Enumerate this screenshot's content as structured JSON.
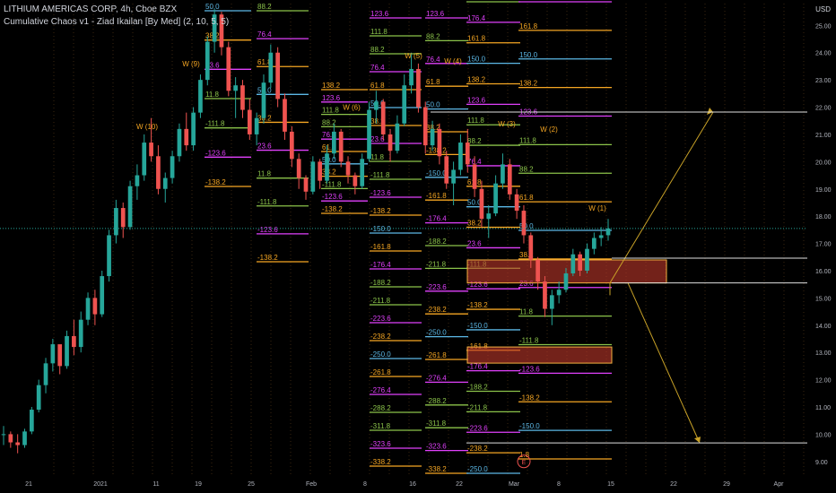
{
  "header": {
    "symbol_line": "LITHIUM AMERICAS CORP, 4h, Cboe BZX",
    "indicator_line": "Cumulative Chaos v1 - Ziad Ikailan [By Med] (2, 10, 5, 5)"
  },
  "currency": "USD",
  "colors": {
    "background": "#000000",
    "up": "#26a69a",
    "down": "#ef5350",
    "arrow": "#c9a227",
    "zone_fill": "#c0392b",
    "zone_border": "#f5b041"
  },
  "chart_data": {
    "type": "candlestick",
    "y_axis": {
      "min": 8.5,
      "max": 25.8,
      "ticks": [
        "25.00",
        "24.00",
        "23.00",
        "22.00",
        "21.00",
        "20.00",
        "19.00",
        "18.00",
        "17.00",
        "16.00",
        "15.00",
        "14.00",
        "13.00",
        "12.00",
        "11.00",
        "10.00",
        "9.00"
      ]
    },
    "x_axis": {
      "ticks": [
        "21",
        "2021",
        "11",
        "19",
        "25",
        "Feb",
        "8",
        "16",
        "22",
        "Mar",
        "8",
        "15",
        "22",
        "29",
        "Apr"
      ]
    },
    "price_tags": [
      {
        "value": "21.82",
        "style": "outline"
      },
      {
        "value": "17.55",
        "style": "current"
      },
      {
        "value": "16.46",
        "style": "outline"
      },
      {
        "value": "15.55",
        "style": "outline"
      },
      {
        "value": "9.68",
        "style": "outline"
      }
    ],
    "wave_labels": [
      "W (10)",
      "W (9)",
      "W (6)",
      "W (5)",
      "W (4)",
      "W (3)",
      "W (2)",
      "W (1)"
    ],
    "circle_label": "E",
    "fib_sets": [
      {
        "levels": [
          {
            "text": "50.0",
            "color": "#5cb8e6"
          },
          {
            "text": "38.2",
            "color": "#f5a623"
          },
          {
            "text": "23.6",
            "color": "#e040fb"
          },
          {
            "text": "11.8",
            "color": "#8bc34a"
          },
          {
            "text": "-111.8",
            "color": "#8bc34a"
          },
          {
            "text": "-123.6",
            "color": "#e040fb"
          },
          {
            "text": "-138.2",
            "color": "#f5a623"
          }
        ]
      },
      {
        "levels": [
          {
            "text": "88.2",
            "color": "#8bc34a"
          },
          {
            "text": "76.4",
            "color": "#e040fb"
          },
          {
            "text": "61.8",
            "color": "#f5a623"
          },
          {
            "text": "50.0",
            "color": "#5cb8e6"
          },
          {
            "text": "38.2",
            "color": "#f5a623"
          },
          {
            "text": "23.6",
            "color": "#e040fb"
          },
          {
            "text": "11.8",
            "color": "#8bc34a"
          },
          {
            "text": "-111.8",
            "color": "#8bc34a"
          },
          {
            "text": "-123.6",
            "color": "#e040fb"
          },
          {
            "text": "-138.2",
            "color": "#f5a623"
          }
        ]
      },
      {
        "levels": [
          {
            "text": "138.2",
            "color": "#f5a623"
          },
          {
            "text": "123.6",
            "color": "#e040fb"
          },
          {
            "text": "111.8",
            "color": "#8bc34a"
          },
          {
            "text": "88.2",
            "color": "#8bc34a"
          },
          {
            "text": "76.4",
            "color": "#e040fb"
          },
          {
            "text": "61.8",
            "color": "#f5a623"
          },
          {
            "text": "50.0",
            "color": "#5cb8e6"
          },
          {
            "text": "38.2",
            "color": "#f5a623"
          },
          {
            "text": "-111.8",
            "color": "#8bc34a"
          },
          {
            "text": "-123.6",
            "color": "#e040fb"
          },
          {
            "text": "-138.2",
            "color": "#f5a623"
          }
        ]
      },
      {
        "levels": [
          {
            "text": "123.6",
            "color": "#e040fb"
          },
          {
            "text": "111.8",
            "color": "#8bc34a"
          },
          {
            "text": "88.2",
            "color": "#8bc34a"
          },
          {
            "text": "76.4",
            "color": "#e040fb"
          },
          {
            "text": "61.8",
            "color": "#f5a623"
          },
          {
            "text": "50.0",
            "color": "#5cb8e6"
          },
          {
            "text": "38.2",
            "color": "#f5a623"
          },
          {
            "text": "23.6",
            "color": "#e040fb"
          },
          {
            "text": "11.8",
            "color": "#8bc34a"
          },
          {
            "text": "-111.8",
            "color": "#8bc34a"
          },
          {
            "text": "-123.6",
            "color": "#e040fb"
          },
          {
            "text": "-138.2",
            "color": "#f5a623"
          },
          {
            "text": "-150.0",
            "color": "#5cb8e6"
          },
          {
            "text": "-161.8",
            "color": "#f5a623"
          },
          {
            "text": "-176.4",
            "color": "#e040fb"
          },
          {
            "text": "-188.2",
            "color": "#8bc34a"
          },
          {
            "text": "-211.8",
            "color": "#8bc34a"
          },
          {
            "text": "-223.6",
            "color": "#e040fb"
          },
          {
            "text": "-238.2",
            "color": "#f5a623"
          },
          {
            "text": "-250.0",
            "color": "#5cb8e6"
          },
          {
            "text": "-261.8",
            "color": "#f5a623"
          },
          {
            "text": "-276.4",
            "color": "#e040fb"
          },
          {
            "text": "-288.2",
            "color": "#8bc34a"
          },
          {
            "text": "-311.8",
            "color": "#8bc34a"
          },
          {
            "text": "-323.6",
            "color": "#e040fb"
          },
          {
            "text": "-338.2",
            "color": "#f5a623"
          }
        ]
      },
      {
        "levels": [
          {
            "text": "123.6",
            "color": "#e040fb"
          },
          {
            "text": "88.2",
            "color": "#8bc34a"
          },
          {
            "text": "76.4",
            "color": "#e040fb"
          },
          {
            "text": "61.8",
            "color": "#f5a623"
          },
          {
            "text": "50.0",
            "color": "#5cb8e6"
          },
          {
            "text": "38.2",
            "color": "#f5a623"
          },
          {
            "text": "-138.2",
            "color": "#f5a623"
          },
          {
            "text": "-150.0",
            "color": "#5cb8e6"
          },
          {
            "text": "-161.8",
            "color": "#f5a623"
          },
          {
            "text": "-176.4",
            "color": "#e040fb"
          },
          {
            "text": "-188.2",
            "color": "#8bc34a"
          },
          {
            "text": "-211.8",
            "color": "#8bc34a"
          },
          {
            "text": "-223.6",
            "color": "#e040fb"
          },
          {
            "text": "-238.2",
            "color": "#f5a623"
          },
          {
            "text": "-250.0",
            "color": "#5cb8e6"
          },
          {
            "text": "-261.8",
            "color": "#f5a623"
          },
          {
            "text": "-276.4",
            "color": "#e040fb"
          },
          {
            "text": "-288.2",
            "color": "#8bc34a"
          },
          {
            "text": "-311.8",
            "color": "#8bc34a"
          },
          {
            "text": "-323.6",
            "color": "#e040fb"
          },
          {
            "text": "-338.2",
            "color": "#f5a623"
          }
        ]
      },
      {
        "levels": [
          {
            "text": "188.2",
            "color": "#8bc34a"
          },
          {
            "text": "176.4",
            "color": "#e040fb"
          },
          {
            "text": "161.8",
            "color": "#f5a623"
          },
          {
            "text": "150.0",
            "color": "#5cb8e6"
          },
          {
            "text": "138.2",
            "color": "#f5a623"
          },
          {
            "text": "123.6",
            "color": "#e040fb"
          },
          {
            "text": "111.8",
            "color": "#8bc34a"
          },
          {
            "text": "88.2",
            "color": "#8bc34a"
          },
          {
            "text": "76.4",
            "color": "#e040fb"
          },
          {
            "text": "61.8",
            "color": "#f5a623"
          },
          {
            "text": "50.0",
            "color": "#5cb8e6"
          },
          {
            "text": "38.2",
            "color": "#f5a623"
          },
          {
            "text": "23.6",
            "color": "#e040fb"
          },
          {
            "text": "-111.8",
            "color": "#8bc34a"
          },
          {
            "text": "-123.6",
            "color": "#e040fb"
          },
          {
            "text": "-138.2",
            "color": "#f5a623"
          },
          {
            "text": "-150.0",
            "color": "#5cb8e6"
          },
          {
            "text": "-161.8",
            "color": "#f5a623"
          },
          {
            "text": "-176.4",
            "color": "#e040fb"
          },
          {
            "text": "-188.2",
            "color": "#8bc34a"
          },
          {
            "text": "-211.8",
            "color": "#8bc34a"
          },
          {
            "text": "-223.6",
            "color": "#e040fb"
          },
          {
            "text": "-238.2",
            "color": "#f5a623"
          },
          {
            "text": "-250.0",
            "color": "#5cb8e6"
          }
        ]
      },
      {
        "levels": [
          {
            "text": "176.4",
            "color": "#e040fb"
          },
          {
            "text": "161.8",
            "color": "#f5a623"
          },
          {
            "text": "150.0",
            "color": "#5cb8e6"
          },
          {
            "text": "138.2",
            "color": "#f5a623"
          },
          {
            "text": "123.6",
            "color": "#e040fb"
          },
          {
            "text": "111.8",
            "color": "#8bc34a"
          },
          {
            "text": "88.2",
            "color": "#8bc34a"
          },
          {
            "text": "61.8",
            "color": "#f5a623"
          },
          {
            "text": "50.0",
            "color": "#5cb8e6"
          },
          {
            "text": "38.2",
            "color": "#f5a623"
          },
          {
            "text": "23.6",
            "color": "#e040fb"
          },
          {
            "text": "11.8",
            "color": "#8bc34a"
          },
          {
            "text": "-111.8",
            "color": "#8bc34a"
          },
          {
            "text": "-123.6",
            "color": "#e040fb"
          },
          {
            "text": "-138.2",
            "color": "#f5a623"
          },
          {
            "text": "-150.0",
            "color": "#5cb8e6"
          },
          {
            "text": "1.8",
            "color": "#f5a623"
          }
        ]
      }
    ],
    "candles": [
      [
        10.0,
        10.3,
        9.6,
        10.0
      ],
      [
        10.0,
        10.1,
        9.5,
        9.7
      ],
      [
        9.7,
        10.0,
        9.3,
        9.6
      ],
      [
        9.6,
        10.2,
        9.5,
        10.1
      ],
      [
        10.1,
        11.0,
        10.0,
        10.9
      ],
      [
        10.9,
        12.0,
        10.8,
        11.8
      ],
      [
        11.8,
        12.8,
        11.5,
        12.6
      ],
      [
        12.6,
        13.5,
        12.3,
        13.3
      ],
      [
        13.3,
        13.2,
        12.2,
        12.5
      ],
      [
        12.5,
        13.8,
        12.4,
        13.6
      ],
      [
        13.6,
        14.2,
        12.9,
        13.2
      ],
      [
        13.2,
        14.5,
        13.0,
        14.2
      ],
      [
        14.2,
        15.2,
        14.0,
        15.0
      ],
      [
        15.0,
        15.3,
        14.0,
        14.4
      ],
      [
        14.4,
        16.0,
        14.3,
        15.8
      ],
      [
        15.8,
        17.5,
        15.6,
        17.3
      ],
      [
        17.3,
        18.6,
        17.0,
        18.3
      ],
      [
        18.3,
        18.5,
        17.2,
        17.6
      ],
      [
        17.6,
        19.3,
        17.5,
        19.1
      ],
      [
        19.1,
        19.9,
        18.6,
        19.5
      ],
      [
        19.5,
        21.0,
        19.3,
        20.7
      ],
      [
        20.7,
        21.6,
        20.0,
        20.2
      ],
      [
        20.2,
        20.6,
        18.8,
        19.0
      ],
      [
        19.0,
        19.6,
        18.5,
        19.4
      ],
      [
        19.4,
        20.4,
        19.2,
        20.2
      ],
      [
        20.2,
        21.4,
        20.0,
        21.2
      ],
      [
        21.2,
        21.8,
        20.4,
        20.6
      ],
      [
        20.6,
        22.0,
        20.4,
        21.8
      ],
      [
        21.8,
        23.2,
        21.6,
        23.0
      ],
      [
        23.0,
        24.6,
        22.8,
        24.4
      ],
      [
        24.4,
        25.6,
        24.0,
        25.4
      ],
      [
        25.4,
        25.5,
        23.9,
        24.2
      ],
      [
        24.2,
        24.4,
        22.4,
        22.6
      ],
      [
        22.6,
        23.1,
        21.6,
        22.8
      ],
      [
        22.8,
        23.0,
        21.6,
        21.9
      ],
      [
        21.9,
        22.3,
        20.8,
        21.0
      ],
      [
        21.0,
        21.8,
        20.6,
        21.6
      ],
      [
        21.6,
        23.2,
        21.4,
        22.9
      ],
      [
        22.9,
        24.3,
        22.7,
        24.0
      ],
      [
        24.0,
        24.2,
        22.0,
        22.3
      ],
      [
        22.3,
        22.5,
        20.8,
        21.1
      ],
      [
        21.1,
        21.3,
        19.8,
        20.1
      ],
      [
        20.1,
        20.3,
        19.0,
        19.4
      ],
      [
        19.4,
        19.5,
        18.6,
        18.9
      ],
      [
        18.9,
        20.2,
        18.8,
        20.0
      ],
      [
        20.0,
        20.1,
        19.0,
        19.3
      ],
      [
        19.3,
        20.6,
        19.2,
        20.3
      ],
      [
        20.3,
        21.4,
        20.1,
        21.1
      ],
      [
        21.1,
        21.2,
        19.8,
        20.0
      ],
      [
        20.0,
        20.2,
        19.2,
        19.5
      ],
      [
        19.5,
        19.6,
        18.8,
        19.1
      ],
      [
        19.1,
        20.3,
        19.0,
        20.1
      ],
      [
        20.1,
        22.2,
        20.0,
        21.9
      ],
      [
        21.9,
        22.6,
        21.4,
        22.2
      ],
      [
        22.2,
        22.3,
        20.8,
        21.0
      ],
      [
        21.0,
        21.2,
        20.0,
        20.4
      ],
      [
        20.4,
        21.7,
        20.3,
        21.4
      ],
      [
        21.4,
        23.2,
        21.3,
        22.8
      ],
      [
        22.8,
        24.0,
        22.5,
        23.4
      ],
      [
        23.4,
        23.6,
        21.8,
        22.0
      ],
      [
        22.0,
        22.2,
        20.3,
        20.6
      ],
      [
        20.6,
        21.5,
        20.4,
        21.2
      ],
      [
        21.2,
        21.4,
        19.9,
        20.2
      ],
      [
        20.2,
        20.4,
        19.0,
        19.2
      ],
      [
        19.2,
        20.0,
        18.4,
        19.7
      ],
      [
        19.7,
        21.0,
        19.5,
        20.7
      ],
      [
        20.7,
        21.2,
        19.6,
        19.9
      ],
      [
        19.9,
        20.2,
        18.7,
        19.0
      ],
      [
        19.0,
        19.3,
        17.6,
        17.9
      ],
      [
        17.9,
        18.4,
        17.2,
        18.1
      ],
      [
        18.1,
        19.5,
        18.0,
        19.2
      ],
      [
        19.2,
        20.3,
        19.0,
        19.9
      ],
      [
        19.9,
        20.1,
        18.6,
        18.8
      ],
      [
        18.8,
        19.0,
        17.9,
        18.2
      ],
      [
        18.2,
        18.4,
        17.0,
        17.3
      ],
      [
        17.3,
        17.4,
        16.1,
        16.4
      ],
      [
        16.4,
        16.5,
        15.3,
        15.6
      ],
      [
        15.6,
        15.8,
        14.3,
        14.6
      ],
      [
        14.6,
        15.3,
        14.0,
        15.1
      ],
      [
        15.1,
        15.6,
        14.8,
        15.3
      ],
      [
        15.3,
        16.1,
        15.2,
        15.9
      ],
      [
        15.9,
        16.8,
        15.8,
        16.6
      ],
      [
        16.6,
        16.7,
        15.8,
        16.0
      ],
      [
        16.0,
        17.0,
        15.9,
        16.8
      ],
      [
        16.8,
        17.4,
        16.6,
        17.2
      ],
      [
        17.2,
        17.6,
        16.9,
        17.3
      ],
      [
        17.3,
        17.9,
        17.1,
        17.55
      ]
    ]
  }
}
